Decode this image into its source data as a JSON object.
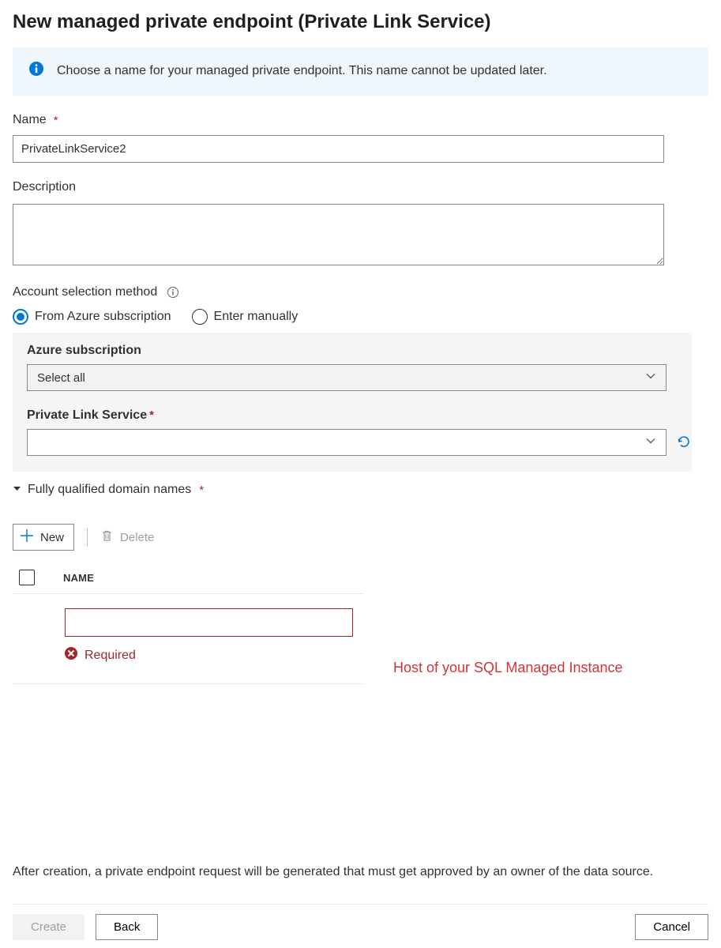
{
  "title": "New managed private endpoint (Private Link Service)",
  "banner": {
    "text": "Choose a name for your managed private endpoint. This name cannot be updated later."
  },
  "fields": {
    "name_label": "Name",
    "name_value": "PrivateLinkService2",
    "description_label": "Description",
    "description_value": "",
    "account_method_label": "Account selection method",
    "radio_from_azure": "From Azure subscription",
    "radio_enter_manually": "Enter manually",
    "azure_sub_label": "Azure subscription",
    "azure_sub_value": "Select all",
    "pls_label": "Private Link Service",
    "pls_value": "",
    "fqdn_label": "Fully qualified domain names"
  },
  "toolbar": {
    "new_label": "New",
    "delete_label": "Delete"
  },
  "table": {
    "col_name": "NAME",
    "required_msg": "Required"
  },
  "annotation": "Host of your SQL Managed Instance",
  "footer_note": "After creation, a private endpoint request will be generated that must get approved by an owner of the data source.",
  "buttons": {
    "create": "Create",
    "back": "Back",
    "cancel": "Cancel"
  }
}
